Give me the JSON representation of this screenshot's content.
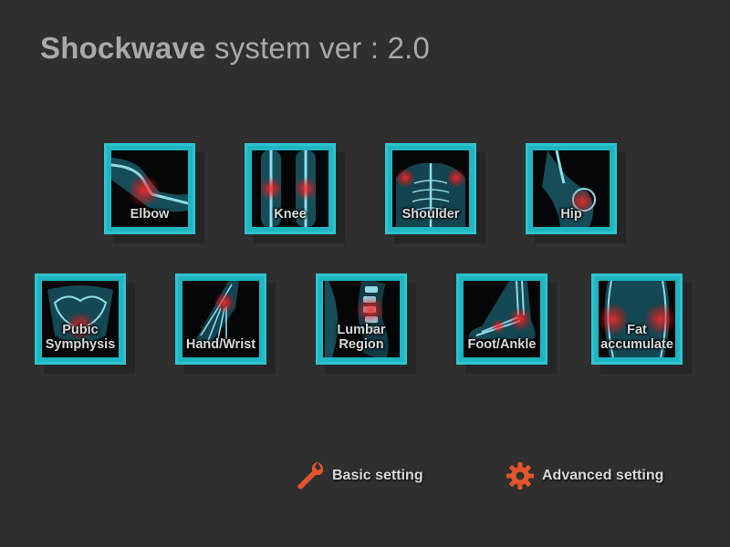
{
  "header": {
    "brand": "Shockwave",
    "subtitle": "system ver :",
    "version": "2.0"
  },
  "tiles": [
    {
      "label": "Elbow",
      "icon": "elbow-xray-icon"
    },
    {
      "label": "Knee",
      "icon": "knee-xray-icon"
    },
    {
      "label": "Shoulder",
      "icon": "shoulder-xray-icon"
    },
    {
      "label": "Hip",
      "icon": "hip-xray-icon"
    },
    {
      "label": "Pubic Symphysis",
      "icon": "pelvis-xray-icon"
    },
    {
      "label": "Hand/Wrist",
      "icon": "hand-xray-icon"
    },
    {
      "label": "Lumbar Region",
      "icon": "lumbar-xray-icon"
    },
    {
      "label": "Foot/Ankle",
      "icon": "foot-xray-icon"
    },
    {
      "label": "Fat accumulate",
      "icon": "abdomen-xray-icon"
    }
  ],
  "settings": {
    "basic": {
      "label": "Basic setting",
      "icon": "wrench-icon"
    },
    "advanced": {
      "label": "Advanced setting",
      "icon": "gear-icon"
    }
  },
  "colors": {
    "background": "#2f2f2f",
    "tile_frame": "#2ec4cf",
    "highlight_red": "#e0202a",
    "icon_orange": "#e2552c"
  }
}
